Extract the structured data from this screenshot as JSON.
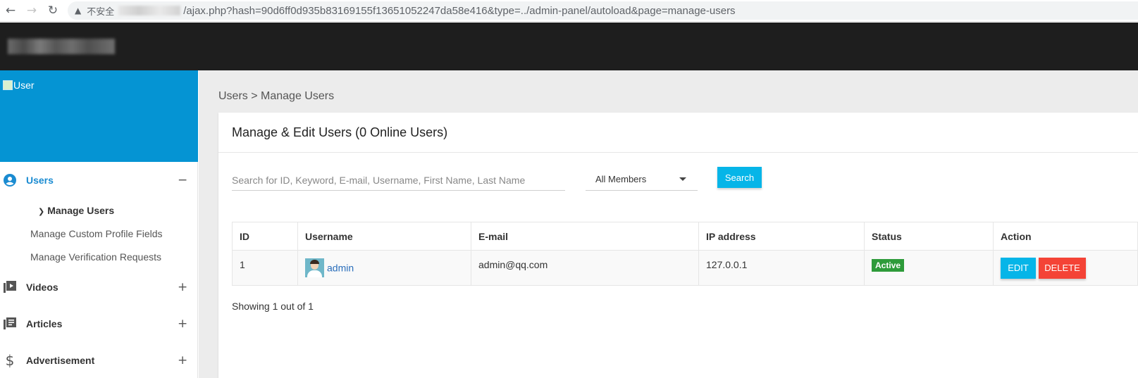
{
  "browser": {
    "insecure_label": "不安全",
    "url": "/ajax.php?hash=90d6ff0d935b83169155f13651052247da58e416&type=../admin-panel/autoload&page=manage-users"
  },
  "sidebar": {
    "user_image_alt": "User",
    "sections": [
      {
        "label": "Users",
        "toggle": "−"
      },
      {
        "label": "Videos",
        "toggle": "+"
      },
      {
        "label": "Articles",
        "toggle": "+"
      },
      {
        "label": "Advertisement",
        "toggle": "+"
      }
    ],
    "users_submenu": [
      {
        "label": "Manage Users"
      },
      {
        "label": "Manage Custom Profile Fields"
      },
      {
        "label": "Manage Verification Requests"
      }
    ]
  },
  "breadcrumb": "Users > Manage Users",
  "card": {
    "title": "Manage & Edit Users (0 Online Users)",
    "search_placeholder": "Search for ID, Keyword, E-mail, Username, First Name, Last Name",
    "member_filter": "All Members",
    "search_button": "Search"
  },
  "table": {
    "columns": [
      "ID",
      "Username",
      "E-mail",
      "IP address",
      "Status",
      "Action"
    ],
    "rows": [
      {
        "id": "1",
        "username": "admin",
        "email": "admin@qq.com",
        "ip": "127.0.0.1",
        "status": "Active",
        "edit_label": "EDIT",
        "delete_label": "DELETE"
      }
    ]
  },
  "showing_text": "Showing 1 out of 1",
  "colors": {
    "header_bg": "#1e1e1e",
    "sidebar_banner": "#0594d3",
    "accent": "#06b5e8",
    "danger": "#f44336",
    "success": "#2e9b3a",
    "link": "#2a6ebb"
  }
}
